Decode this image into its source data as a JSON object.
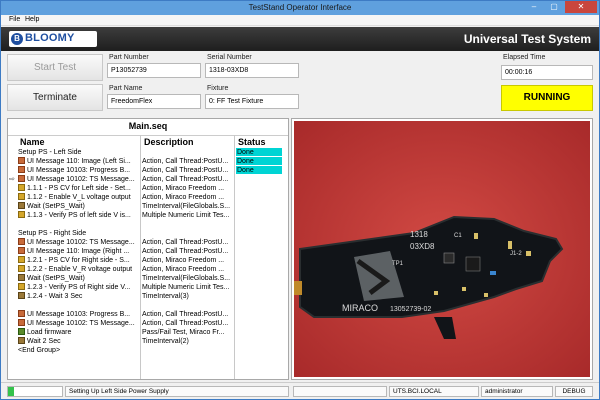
{
  "window": {
    "title": "TestStand Operator Interface"
  },
  "menu": [
    "File",
    "Help"
  ],
  "header": {
    "logo_text": "BLOOMY",
    "system_title": "Universal Test System"
  },
  "controls": {
    "start_label": "Start Test",
    "terminate_label": "Terminate"
  },
  "fields": {
    "part_number_label": "Part Number",
    "part_number": "P13052739",
    "serial_number_label": "Serial Number",
    "serial_number": "1318-03XD8",
    "part_name_label": "Part Name",
    "part_name": "FreedomFlex",
    "fixture_label": "Fixture",
    "fixture": "0: FF Test Fixture",
    "elapsed_label": "Elapsed Time",
    "elapsed": "00:00:16"
  },
  "run_state": {
    "label": "RUNNING",
    "color": "#ffff00"
  },
  "sequence": {
    "title": "Main.seq",
    "columns": [
      "Name",
      "Description",
      "Status"
    ],
    "rows": [
      {
        "name": "Setup PS - Left Side",
        "desc": "",
        "status": "Done",
        "icon": ""
      },
      {
        "name": "UI Message 110: Image (Left Si...",
        "desc": "Action,  Call Thread:PostU...",
        "status": "Done",
        "icon": "message-icon"
      },
      {
        "name": "UI Message 10103: Progress B...",
        "desc": "Action,  Call Thread:PostU...",
        "status": "Done",
        "icon": "message-icon"
      },
      {
        "name": "UI Message 10102: TS Message...",
        "desc": "Action,  Call Thread:PostU...",
        "status": "",
        "icon": "message-icon",
        "current": true
      },
      {
        "name": "1.1.1 - PS CV for Left side - Set...",
        "desc": "Action,  Miraco Freedom ...",
        "status": "",
        "icon": "step-icon"
      },
      {
        "name": "1.1.2 - Enable V_L voltage output",
        "desc": "Action,  Miraco Freedom ...",
        "status": "",
        "icon": "step-icon"
      },
      {
        "name": "Wait (SetPS_Wait)",
        "desc": "TimeInterval(FileGlobals.S...",
        "status": "",
        "icon": "wait-icon"
      },
      {
        "name": "1.1.3 - Verify PS of left side V is...",
        "desc": "Multiple Numeric Limit Tes...",
        "status": "",
        "icon": "step-icon"
      },
      {
        "name": "",
        "desc": "",
        "status": "",
        "icon": ""
      },
      {
        "name": "Setup PS - Right Side",
        "desc": "",
        "status": "",
        "icon": ""
      },
      {
        "name": "UI Message 10102: TS Message...",
        "desc": "Action,  Call Thread:PostU...",
        "status": "",
        "icon": "message-icon"
      },
      {
        "name": "UI Message 110: Image (Right ...",
        "desc": "Action,  Call Thread:PostU...",
        "status": "",
        "icon": "message-icon"
      },
      {
        "name": "1.2.1 - PS CV for Right side - S...",
        "desc": "Action,  Miraco Freedom ...",
        "status": "",
        "icon": "step-icon"
      },
      {
        "name": "1.2.2 - Enable V_R voltage output",
        "desc": "Action,  Miraco Freedom ...",
        "status": "",
        "icon": "step-icon"
      },
      {
        "name": "Wait (SetPS_Wait)",
        "desc": "TimeInterval(FileGlobals.S...",
        "status": "",
        "icon": "wait-icon"
      },
      {
        "name": "1.2.3 - Verify PS of Right side V...",
        "desc": "Multiple Numeric Limit Tes...",
        "status": "",
        "icon": "step-icon"
      },
      {
        "name": "1.2.4 - Wait 3 Sec",
        "desc": "TimeInterval(3)",
        "status": "",
        "icon": "wait-icon"
      },
      {
        "name": "",
        "desc": "",
        "status": "",
        "icon": ""
      },
      {
        "name": "UI Message 10103: Progress B...",
        "desc": "Action,  Call Thread:PostU...",
        "status": "",
        "icon": "message-icon"
      },
      {
        "name": "UI Message 10102: TS Message...",
        "desc": "Action,  Call Thread:PostU...",
        "status": "",
        "icon": "message-icon"
      },
      {
        "name": "Load firmware",
        "desc": "Pass/Fail Test,  Miraco Fr...",
        "status": "",
        "icon": "load-icon"
      },
      {
        "name": "Wait 2 Sec",
        "desc": "TimeInterval(2)",
        "status": "",
        "icon": "wait-icon"
      },
      {
        "name": "<End Group>",
        "desc": "",
        "status": "",
        "icon": ""
      }
    ]
  },
  "board": {
    "label_1": "1318",
    "label_2": "03XD8",
    "label_3": "MIRACO",
    "label_4": "13052739-02",
    "ref_c1": "C1",
    "ref_tp1": "TP1",
    "ref_j1": "J1-2"
  },
  "status_bar": {
    "progress": 0.12,
    "message": "Setting Up Left Side Power Supply",
    "domain": "UTS.BCI.LOCAL",
    "user": "administrator",
    "mode": "DEBUG"
  }
}
